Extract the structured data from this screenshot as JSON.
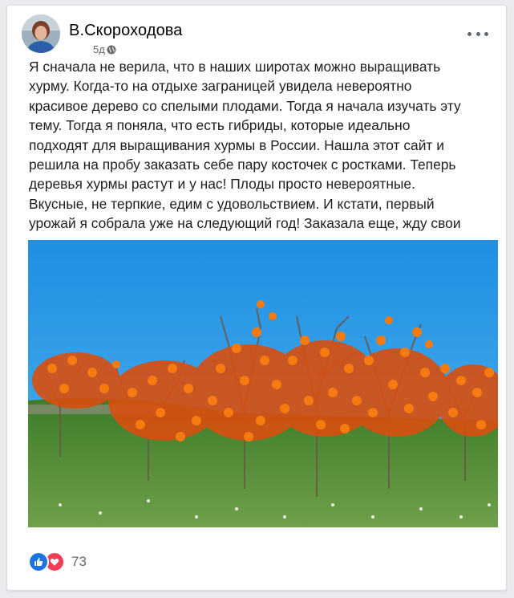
{
  "post": {
    "author": "В.Скороходова",
    "time": "5д",
    "privacy_icon": "globe-icon",
    "more_icon": "more-options-icon",
    "text": "Я сначала не верила, что в наших широтах можно выращивать\nхурму. Когда-то на отдыхе заграницей увидела невероятно\nкрасивое дерево со спелыми плодами. Тогда я начала изучать эту\nтему. Тогда я поняла, что есть гибриды, которые идеально\nподходят для выращивания хурмы в России. Нашла этот сайт и\nрешила на пробу заказать себе пару косточек с ростками. Теперь\nдеревья хурмы растут и у нас! Плоды просто невероятные.\nВкусные, не терпкие, едим с удовольствием. И кстати, первый\nурожай я собрала уже на следующий год! Заказала еще, жду свои\nкосточки.",
    "image_description": "persimmon trees with ripe orange fruit under a blue sky"
  },
  "reactions": {
    "icons": [
      "like-icon",
      "love-icon"
    ],
    "count": "73"
  },
  "colors": {
    "like": "#1b74e4",
    "love": "#f33e58",
    "sky": "#2b9ae6",
    "fruit": "#f36d12",
    "grass": "#4a8a2e"
  }
}
